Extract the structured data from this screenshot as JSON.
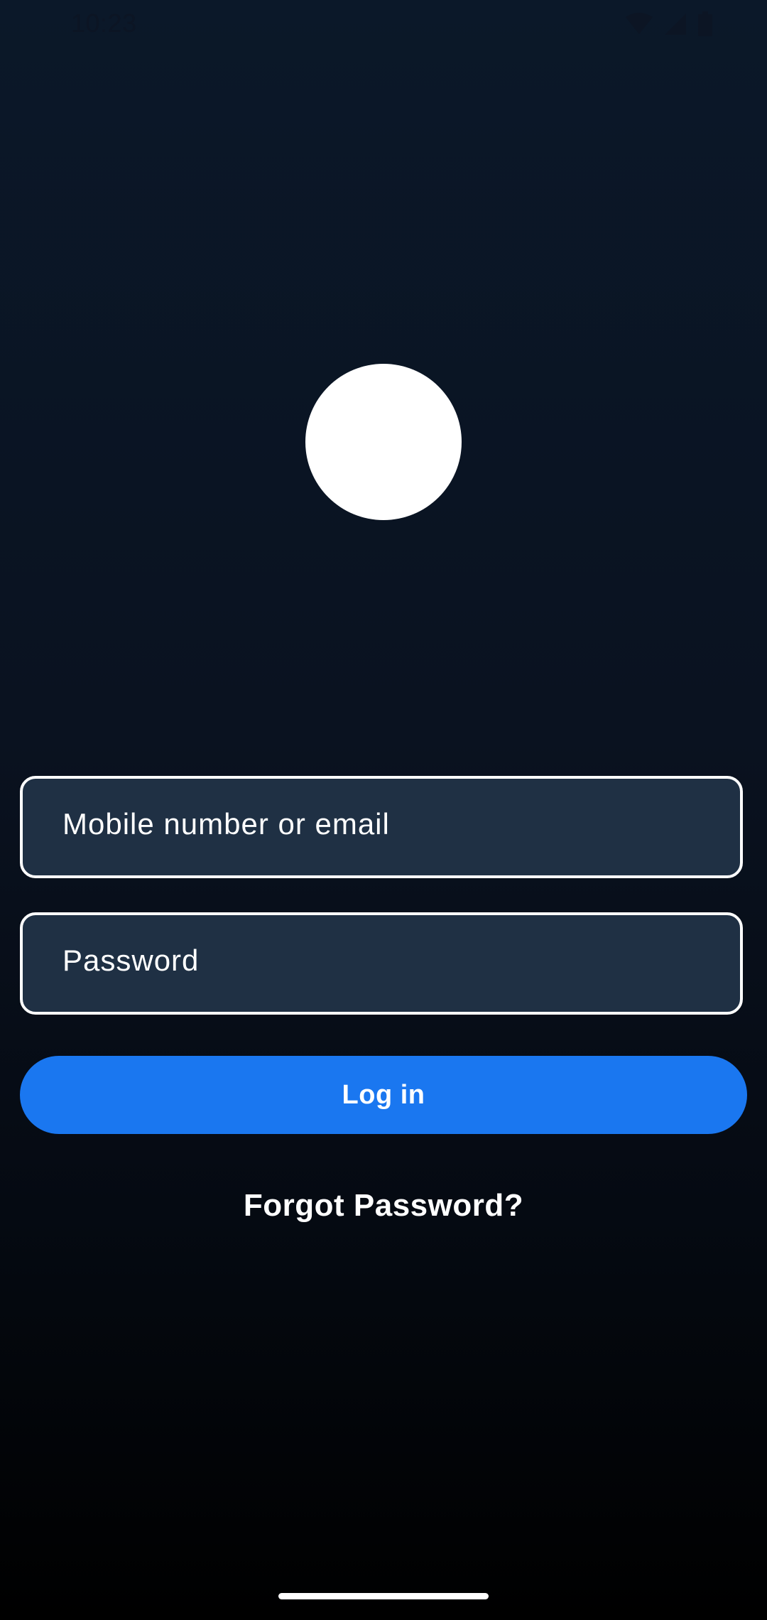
{
  "status_bar": {
    "time": "10:23",
    "icons": [
      "wifi-icon",
      "signal-icon",
      "battery-icon"
    ]
  },
  "login": {
    "email_placeholder": "Mobile number or email",
    "password_placeholder": "Password",
    "login_label": "Log in",
    "forgot_label": "Forgot Password?"
  },
  "colors": {
    "accent": "#1a77f0",
    "field_background": "#1f3044",
    "background_top": "#0b1829",
    "background_bottom": "#000000"
  }
}
